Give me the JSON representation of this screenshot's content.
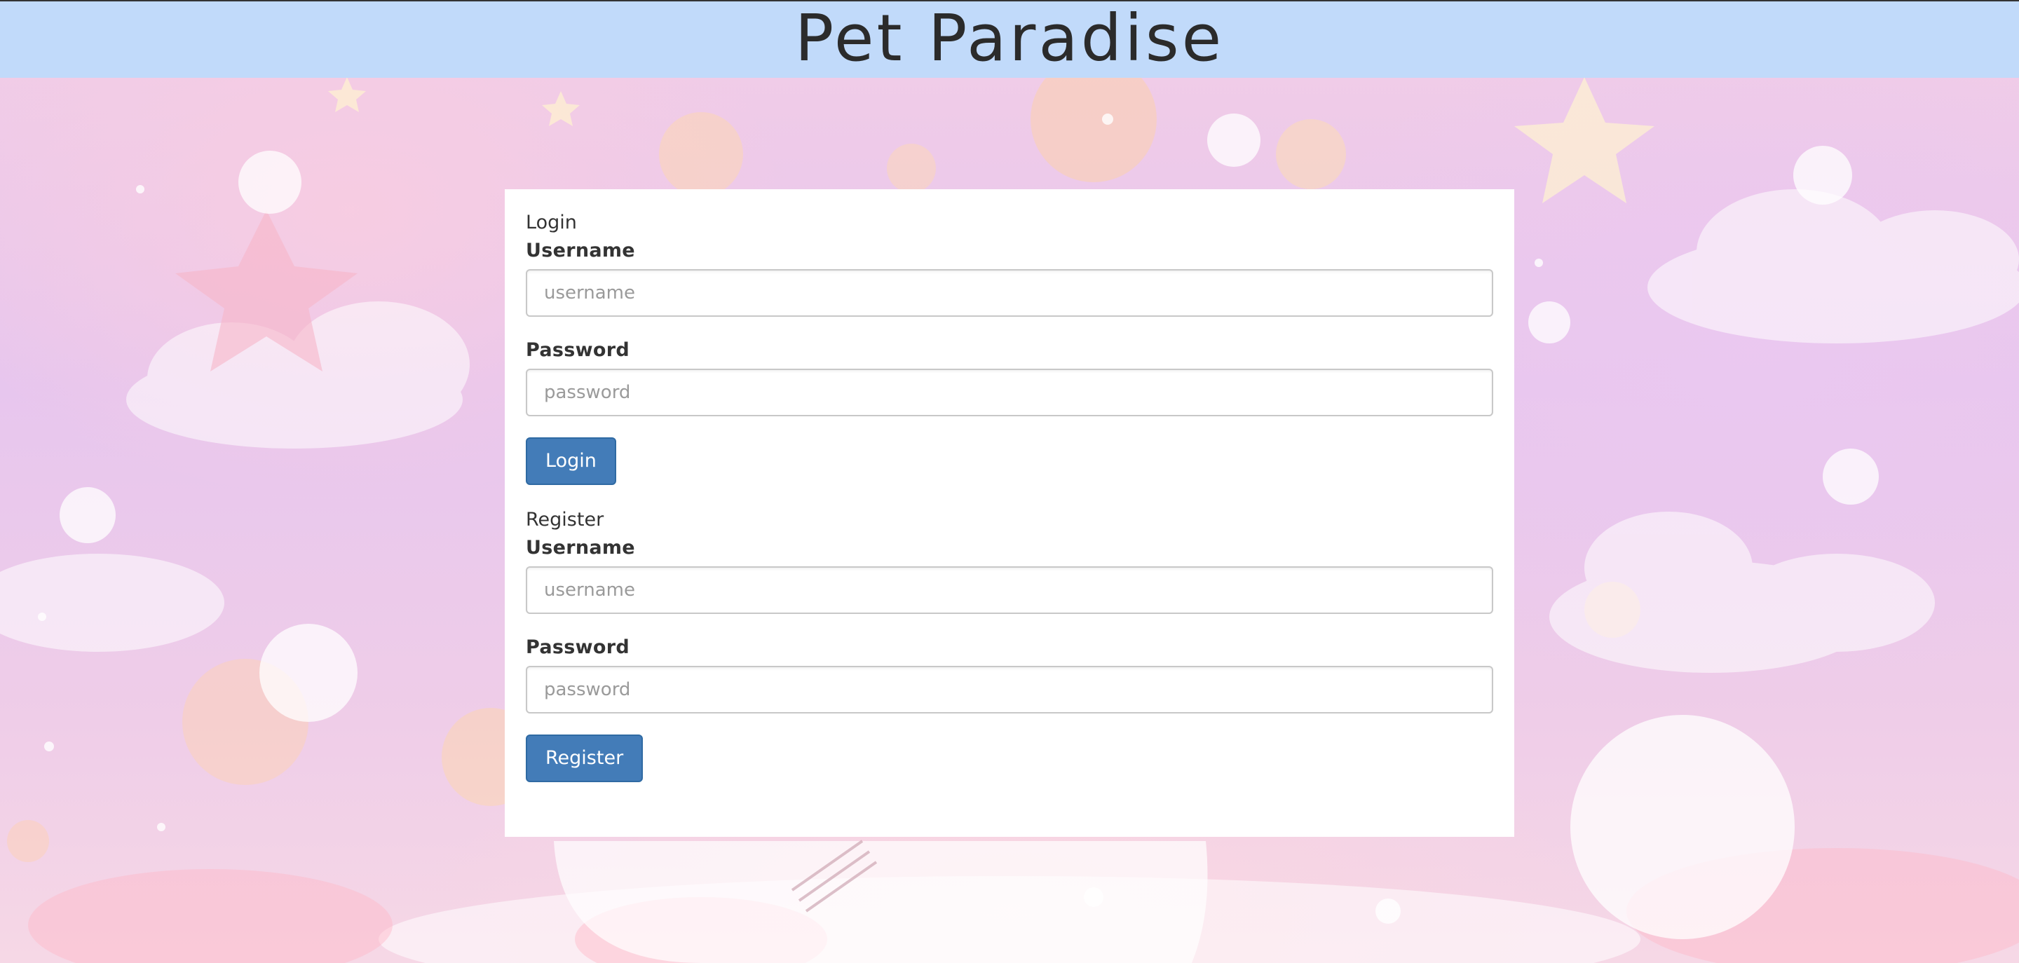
{
  "header": {
    "title": "Pet Paradise"
  },
  "login": {
    "title": "Login",
    "username_label": "Username",
    "username_placeholder": "username",
    "password_label": "Password",
    "password_placeholder": "password",
    "submit_label": "Login"
  },
  "register": {
    "title": "Register",
    "username_label": "Username",
    "username_placeholder": "username",
    "password_label": "Password",
    "password_placeholder": "password",
    "submit_label": "Register"
  },
  "colors": {
    "header_bg": "#c1dafa",
    "button_bg": "#437cb8",
    "card_bg": "#ffffff"
  }
}
